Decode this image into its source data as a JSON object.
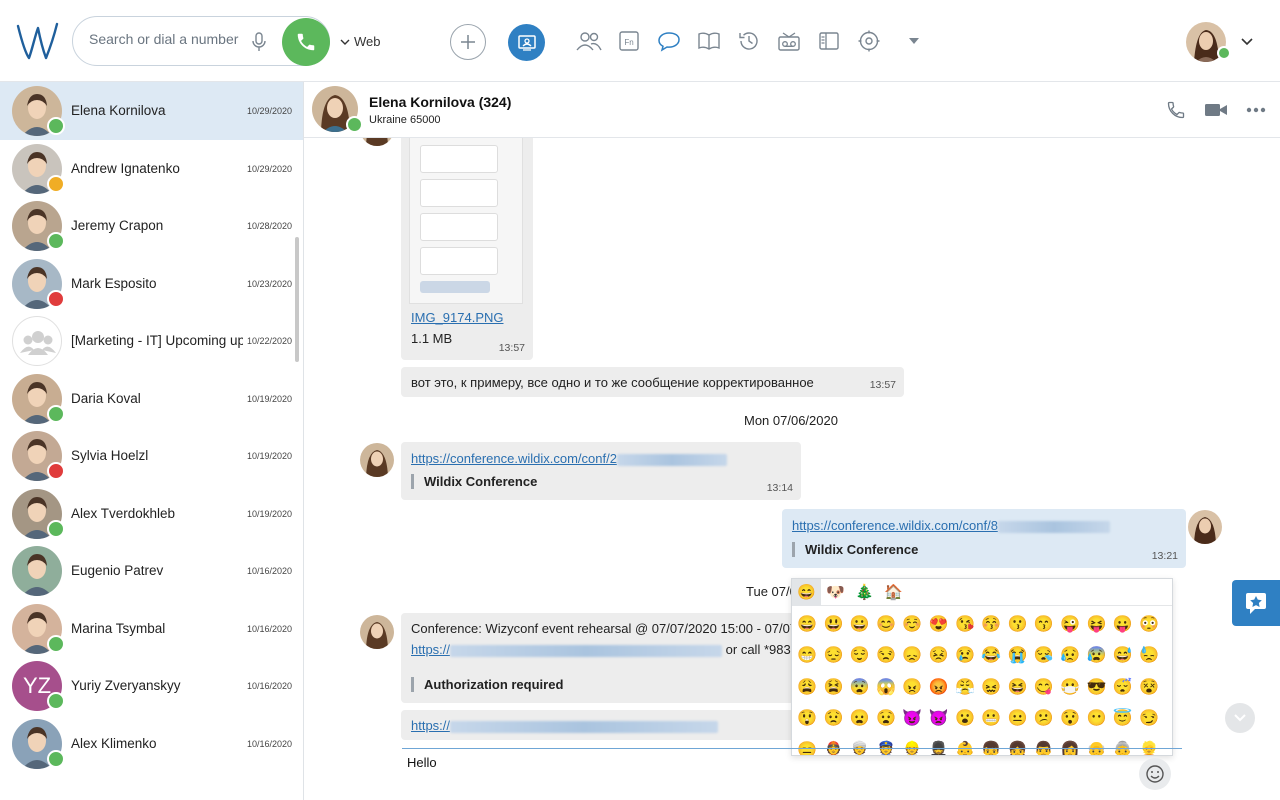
{
  "topbar": {
    "search_placeholder": "Search or dial a number",
    "web_label": "Web"
  },
  "colors": {
    "accent": "#2f80c3",
    "online": "#5cb85c",
    "away": "#f0ad25",
    "busy": "#e03c3c",
    "call": "#5cb85c"
  },
  "contacts": [
    {
      "name": "Elena Kornilova",
      "date": "10/29/2020",
      "status": "online"
    },
    {
      "name": "Andrew Ignatenko",
      "date": "10/29/2020",
      "status": "away"
    },
    {
      "name": "Jeremy Crapon",
      "date": "10/28/2020",
      "status": "online"
    },
    {
      "name": "Mark Esposito",
      "date": "10/23/2020",
      "status": "busy"
    },
    {
      "name": "[Marketing - IT] Upcoming upc",
      "date": "10/22/2020",
      "status": "group"
    },
    {
      "name": "Daria Koval",
      "date": "10/19/2020",
      "status": "online"
    },
    {
      "name": "Sylvia Hoelzl",
      "date": "10/19/2020",
      "status": "busy"
    },
    {
      "name": "Alex Tverdokhleb",
      "date": "10/19/2020",
      "status": "online"
    },
    {
      "name": "Eugenio Patrev",
      "date": "10/16/2020",
      "status": "none"
    },
    {
      "name": "Marina Tsymbal",
      "date": "10/16/2020",
      "status": "online"
    },
    {
      "name": "Yuriy Zveryanskyy",
      "date": "10/16/2020",
      "status": "online",
      "initials": "YZ"
    },
    {
      "name": "Alex Klimenko",
      "date": "10/16/2020",
      "status": "online"
    }
  ],
  "chat": {
    "name": "Elena Kornilova (324)",
    "location": "Ukraine 65000"
  },
  "messages": {
    "file_name": "IMG_9174.PNG",
    "file_size": "1.1 MB",
    "file_time": "13:57",
    "text1": "вот это, к примеру, все одно и то же сообщение корректированное",
    "text1_time": "13:57",
    "date1": "Mon 07/06/2020",
    "link1": "https://conference.wildix.com/conf/2",
    "link1_title": "Wildix Conference",
    "link1_time": "13:14",
    "link2": "https://conference.wildix.com/conf/8",
    "link2_title": "Wildix Conference",
    "link2_time": "13:21",
    "date2": "Tue 07/0",
    "conf_text": "Conference: Wizyconf event rehearsal @ 07/07/2020 15:00 - 07/07",
    "conf_link": "https://",
    "conf_tail": "or call *983",
    "conf_title": "Authorization required",
    "link3": "https://"
  },
  "composer": {
    "value": "Hello"
  },
  "emoji": {
    "tabs": [
      "😄",
      "🐶",
      "🎄",
      "🏠"
    ],
    "grid": [
      "😄",
      "😃",
      "😀",
      "😊",
      "☺️",
      "😍",
      "😘",
      "😚",
      "😗",
      "😙",
      "😜",
      "😝",
      "😛",
      "😳",
      "😁",
      "😔",
      "😌",
      "😒",
      "😞",
      "😣",
      "😢",
      "😂",
      "😭",
      "😪",
      "😥",
      "😰",
      "😅",
      "😓",
      "😩",
      "😫",
      "😨",
      "😱",
      "😠",
      "😡",
      "😤",
      "😖",
      "😆",
      "😋",
      "😷",
      "😎",
      "😴",
      "😵",
      "😲",
      "😟",
      "😦",
      "😧",
      "😈",
      "👿",
      "😮",
      "😬",
      "😐",
      "😕",
      "😯",
      "😶",
      "😇",
      "😏",
      "😑",
      "👲",
      "👳",
      "👮",
      "👷",
      "💂",
      "👶",
      "👦",
      "👧",
      "👨",
      "👩",
      "👴",
      "👵",
      "👱",
      "👼",
      "👸",
      "😺",
      "😸",
      "😻"
    ]
  }
}
